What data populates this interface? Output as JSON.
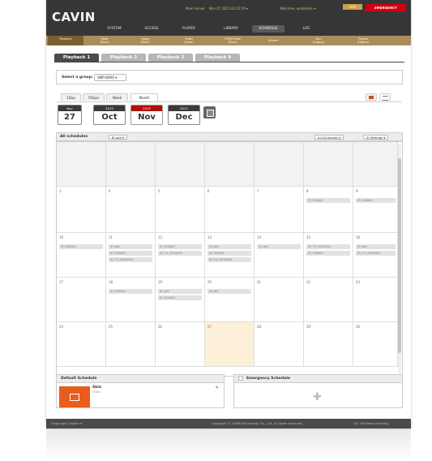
{
  "header": {
    "logo": "CAVIN",
    "main_server": "Main Server",
    "datetime": "Nov 27 2015 04:15:59 ▾",
    "welcome": "Welcome, webadmin ▾",
    "led_label": "LED",
    "emergency": "EMERGENCY"
  },
  "main_nav": [
    {
      "label": "SYSTEM"
    },
    {
      "label": "ACCESS"
    },
    {
      "label": "PLAYER"
    },
    {
      "label": "LIBRARY"
    },
    {
      "label": "SCHEDULE",
      "active": true
    },
    {
      "label": "LOG"
    }
  ],
  "sub_nav": [
    {
      "line1": "Playback",
      "line2": "",
      "active": true
    },
    {
      "line1": "Video",
      "line2": "(Zone)"
    },
    {
      "line1": "Image",
      "line2": "(Zone)"
    },
    {
      "line1": "Ticker",
      "line2": "(Zone)"
    },
    {
      "line1": "HTML/Flash",
      "line2": "(Zone)"
    },
    {
      "line1": "Volume",
      "line2": ""
    },
    {
      "line1": "Skin",
      "line2": "(Legacy)"
    },
    {
      "line1": "Playlist",
      "line2": "(Legacy)"
    }
  ],
  "playback_tabs": [
    {
      "label": "Playback 1",
      "active": true
    },
    {
      "label": "Playback 2"
    },
    {
      "label": "Playback 3"
    },
    {
      "label": "Playback 4"
    }
  ],
  "group": {
    "label": "Select a group:",
    "value": "SMP-8000 ▾"
  },
  "view_tabs": [
    {
      "label": "1Day"
    },
    {
      "label": "5Days"
    },
    {
      "label": "Week"
    },
    {
      "label": "Month",
      "active": true
    }
  ],
  "dates": {
    "today_month": "Nov",
    "today_day": "27",
    "months": [
      {
        "year": "2015",
        "month": "Oct"
      },
      {
        "year": "2015",
        "month": "Nov",
        "current": true
      },
      {
        "year": "2015",
        "month": "Dec"
      }
    ]
  },
  "all_schedules": {
    "title": "All schedules",
    "add": "Add ▾",
    "filter": "All Schedules ▾",
    "settings": "⚙ Settings ▾"
  },
  "calendar": [
    {
      "num": "",
      "events": [],
      "gray": true
    },
    {
      "num": "",
      "events": [],
      "gray": true
    },
    {
      "num": "",
      "events": [],
      "gray": true
    },
    {
      "num": "",
      "events": [],
      "gray": true
    },
    {
      "num": "",
      "events": [],
      "gray": true
    },
    {
      "num": "",
      "events": [],
      "gray": true
    },
    {
      "num": "",
      "events": [],
      "gray": true
    },
    {
      "num": "3",
      "events": []
    },
    {
      "num": "4",
      "events": []
    },
    {
      "num": "5",
      "events": []
    },
    {
      "num": "6",
      "events": []
    },
    {
      "num": "7",
      "events": []
    },
    {
      "num": "8",
      "events": [
        "(E) ONSALE"
      ]
    },
    {
      "num": "9",
      "events": [
        "(E) ONSALE"
      ]
    },
    {
      "num": "10",
      "events": [
        "(E) ONSALE"
      ]
    },
    {
      "num": "11",
      "events": [
        "(E) wiki",
        "(E) ONSALE",
        "(E) TV_20150924"
      ]
    },
    {
      "num": "12",
      "events": [
        "(E) ONSALE",
        "(E) TV_20150924"
      ]
    },
    {
      "num": "13",
      "events": [
        "(E) wiki",
        "(E) ONSALE",
        "(E) TV_20150924"
      ]
    },
    {
      "num": "14",
      "events": [
        "(E) wiki"
      ]
    },
    {
      "num": "15",
      "events": [
        "(E) TV_20150924",
        "(E) ONSALE"
      ]
    },
    {
      "num": "16",
      "events": [
        "(E) wiki",
        "(E) TV_20150924"
      ]
    },
    {
      "num": "17",
      "events": []
    },
    {
      "num": "18",
      "events": [
        "(E) ONSALE"
      ]
    },
    {
      "num": "19",
      "events": [
        "(E) wiki",
        "(E) ONSALE"
      ]
    },
    {
      "num": "20",
      "events": [
        "(E) wiki"
      ]
    },
    {
      "num": "21",
      "events": []
    },
    {
      "num": "22",
      "events": []
    },
    {
      "num": "23",
      "events": []
    },
    {
      "num": "24",
      "events": []
    },
    {
      "num": "25",
      "events": []
    },
    {
      "num": "26",
      "events": []
    },
    {
      "num": "27",
      "events": [],
      "today": true
    },
    {
      "num": "28",
      "events": []
    },
    {
      "num": "29",
      "events": []
    },
    {
      "num": "30",
      "events": []
    }
  ],
  "default_schedule": {
    "title": "Default Schedule",
    "item": "Skin",
    "sub": "Video"
  },
  "emergency_schedule": {
    "title": "Emergency Schedule"
  },
  "footer": {
    "language": "Language: English ▾",
    "copyright": "Copyright © CAYIN Technology Co., Ltd. All rights reserved.",
    "patent": "US, TW Patent Pending"
  },
  "colors": {
    "header": "#363636",
    "subnav": "#a88d5a",
    "accent": "#e85d1c",
    "emergency": "#d10010"
  }
}
